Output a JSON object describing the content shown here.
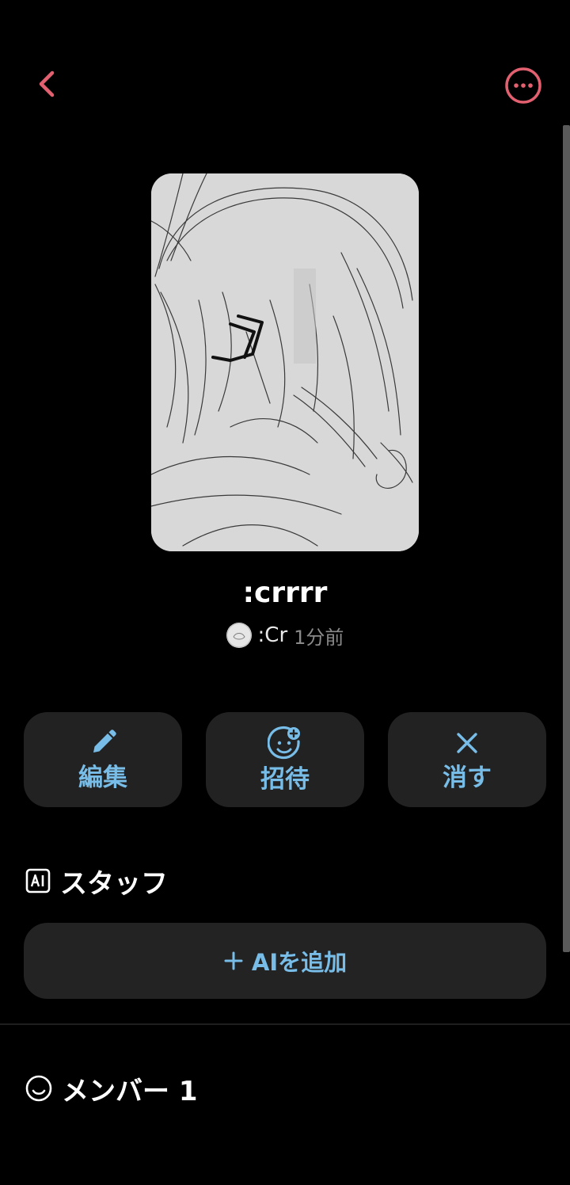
{
  "colors": {
    "accent": "#e2606f",
    "action_text": "#78bde8",
    "card_bg": "#222222",
    "background": "#000000"
  },
  "header": {
    "back_icon": "chevron-left-icon",
    "more_icon": "more-horizontal-icon"
  },
  "room": {
    "title": ":crrrr",
    "author": ":Cr",
    "time": "1分前"
  },
  "actions": [
    {
      "label": "編集",
      "icon": "pencil-icon"
    },
    {
      "label": "招待",
      "icon": "add-person-icon"
    },
    {
      "label": "消す",
      "icon": "close-icon"
    }
  ],
  "staff": {
    "icon": "ai-icon",
    "title": "スタッフ",
    "add_label": "AIを追加"
  },
  "members": {
    "icon": "smile-icon",
    "title": "メンバー 1"
  }
}
